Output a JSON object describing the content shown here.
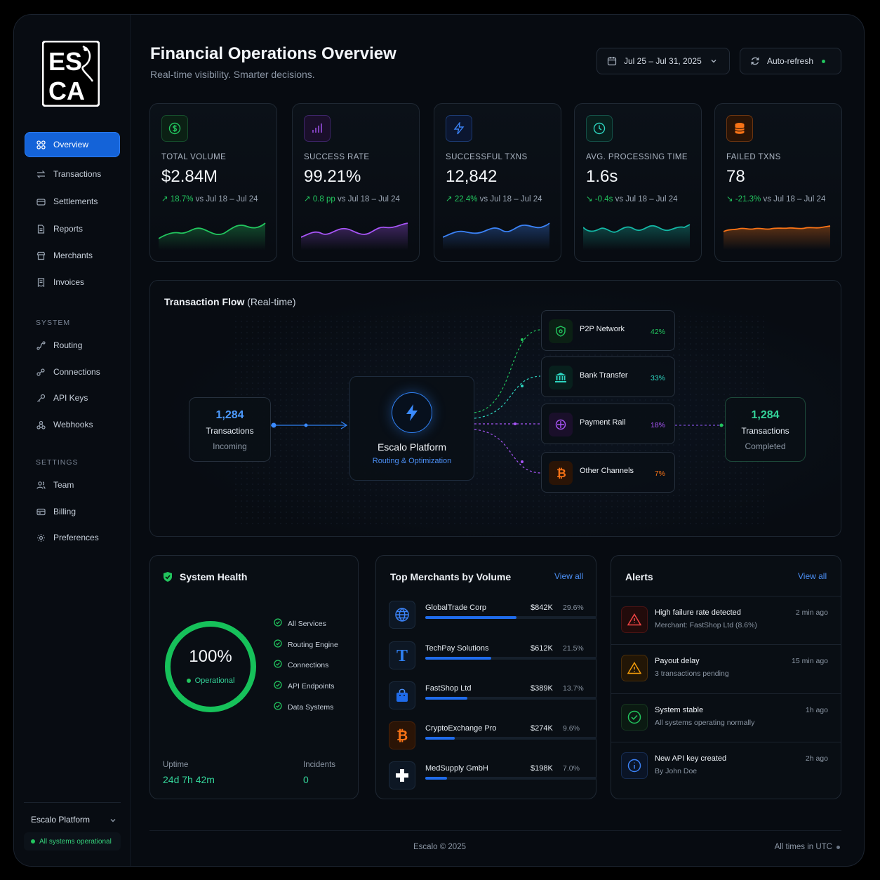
{
  "sidebar": {
    "nav": [
      {
        "label": "Overview",
        "icon": "grid-icon"
      },
      {
        "label": "Transactions",
        "icon": "arrows-icon"
      },
      {
        "label": "Settlements",
        "icon": "wallet-icon"
      },
      {
        "label": "Reports",
        "icon": "document-icon"
      },
      {
        "label": "Merchants",
        "icon": "store-icon"
      },
      {
        "label": "Invoices",
        "icon": "invoice-icon"
      }
    ],
    "system_title": "SYSTEM",
    "system": [
      {
        "label": "Routing",
        "icon": "routing-icon"
      },
      {
        "label": "Connections",
        "icon": "connections-icon"
      },
      {
        "label": "API Keys",
        "icon": "key-icon"
      },
      {
        "label": "Webhooks",
        "icon": "webhook-icon"
      }
    ],
    "settings_title": "SETTINGS",
    "settings": [
      {
        "label": "Team",
        "icon": "team-icon"
      },
      {
        "label": "Billing",
        "icon": "billing-icon"
      },
      {
        "label": "Preferences",
        "icon": "gear-icon"
      }
    ],
    "footer_name": "Escalo Platform",
    "footer_status": "All systems operational"
  },
  "header": {
    "title": "Financial Operations Overview",
    "subtitle": "Real-time visibility. Smarter decisions.",
    "date_range": "Jul 25 – Jul 31, 2025",
    "refresh_label": "Auto-refresh"
  },
  "kpis": [
    {
      "label": "TOTAL VOLUME",
      "value": "$2.84M",
      "change": "18.7%",
      "compare": "vs Jul 18 – Jul 24",
      "color": "#22c55e"
    },
    {
      "label": "SUCCESS RATE",
      "value": "99.21%",
      "change": "0.8 pp",
      "compare": "vs Jul 18 – Jul 24",
      "color": "#a855f7"
    },
    {
      "label": "SUCCESSFUL TXNS",
      "value": "12,842",
      "change": "22.4%",
      "compare": "vs Jul 18 – Jul 24",
      "color": "#3b82f6"
    },
    {
      "label": "AVG. PROCESSING TIME",
      "value": "1.6s",
      "change": "-0.4s",
      "compare": "vs Jul 18 – Jul 24",
      "color": "#14b8a6"
    },
    {
      "label": "FAILED TXNS",
      "value": "78",
      "change": "-21.3%",
      "compare": "vs Jul 18 – Jul 24",
      "color": "#f97316"
    }
  ],
  "flow": {
    "title": "Transaction Flow",
    "title_suffix": "(Real-time)",
    "incoming": {
      "value": "1,284",
      "label": "Transactions",
      "sub": "Incoming"
    },
    "platform": {
      "name": "Escalo Platform",
      "sub": "Routing & Optimization"
    },
    "completed": {
      "value": "1,284",
      "label": "Transactions",
      "sub": "Completed"
    },
    "channels": [
      {
        "name": "P2P Network",
        "pct": "42%",
        "color": "#22c55e"
      },
      {
        "name": "Bank Transfer",
        "pct": "33%",
        "color": "#2dd4bf"
      },
      {
        "name": "Payment Rail",
        "pct": "18%",
        "color": "#a855f7"
      },
      {
        "name": "Other Channels",
        "pct": "7%",
        "color": "#f97316"
      }
    ]
  },
  "health": {
    "title": "System Health",
    "percent": "100%",
    "state": "Operational",
    "services": [
      "All Services",
      "Routing Engine",
      "Connections",
      "API Endpoints",
      "Data Systems"
    ],
    "uptime_label": "Uptime",
    "uptime_value": "24d 7h 42m",
    "incidents_label": "Incidents",
    "incidents_value": "0"
  },
  "merchants": {
    "title": "Top Merchants by Volume",
    "view_all": "View all",
    "rows": [
      {
        "name": "GlobalTrade Corp",
        "value": "$842K",
        "pct": "29.6%",
        "share": 0.296,
        "icon": "globe-icon"
      },
      {
        "name": "TechPay Solutions",
        "value": "$612K",
        "pct": "21.5%",
        "share": 0.215,
        "icon": "t-letter-icon"
      },
      {
        "name": "FastShop Ltd",
        "value": "$389K",
        "pct": "13.7%",
        "share": 0.137,
        "icon": "shopping-bag-icon"
      },
      {
        "name": "CryptoExchange Pro",
        "value": "$274K",
        "pct": "9.6%",
        "share": 0.096,
        "icon": "bitcoin-icon"
      },
      {
        "name": "MedSupply GmbH",
        "value": "$198K",
        "pct": "7.0%",
        "share": 0.07,
        "icon": "medical-cross-icon"
      }
    ]
  },
  "alerts": {
    "title": "Alerts",
    "view_all": "View all",
    "rows": [
      {
        "title": "High failure rate detected",
        "sub": "Merchant: FastShop Ltd (8.6%)",
        "time": "2 min ago",
        "icon": "warning-red-icon"
      },
      {
        "title": "Payout delay",
        "sub": "3 transactions pending",
        "time": "15 min ago",
        "icon": "warning-amber-icon"
      },
      {
        "title": "System stable",
        "sub": "All systems operating normally",
        "time": "1h ago",
        "icon": "check-circle-icon"
      },
      {
        "title": "New API key created",
        "sub": "By John Doe",
        "time": "2h ago",
        "icon": "info-icon"
      }
    ]
  },
  "footer": {
    "copyright": "Escalo © 2025",
    "timezone": "All times in UTC"
  }
}
